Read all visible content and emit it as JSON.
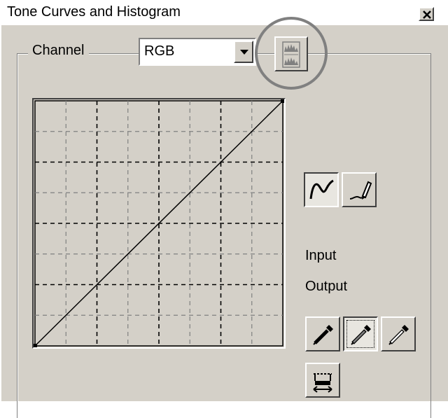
{
  "window": {
    "title": "Tone Curves and Histogram",
    "close_icon": "close-icon"
  },
  "channel": {
    "legend": "Channel",
    "selected": "RGB",
    "dropdown_icon": "chevron-down-icon"
  },
  "toolbar": {
    "histogram_button_icon": "histogram-icon",
    "curve_mode_icon": "smooth-curve-icon",
    "freehand_mode_icon": "pencil-icon"
  },
  "readouts": {
    "input_label": "Input",
    "output_label": "Output"
  },
  "eyedroppers": {
    "black_point_icon": "black-eyedropper-icon",
    "gray_point_icon": "gray-eyedropper-icon",
    "white_point_icon": "white-eyedropper-icon"
  },
  "reset": {
    "icon": "reset-curve-icon"
  },
  "curve": {
    "grid_divisions": 8,
    "points": [
      [
        0,
        0
      ],
      [
        255,
        255
      ]
    ],
    "range": [
      0,
      255
    ]
  },
  "colors": {
    "face": "#d4d0c8",
    "highlight": "#ffffff",
    "shadow": "#404040",
    "grid_dark": "#000000",
    "grid_light": "#808080"
  }
}
